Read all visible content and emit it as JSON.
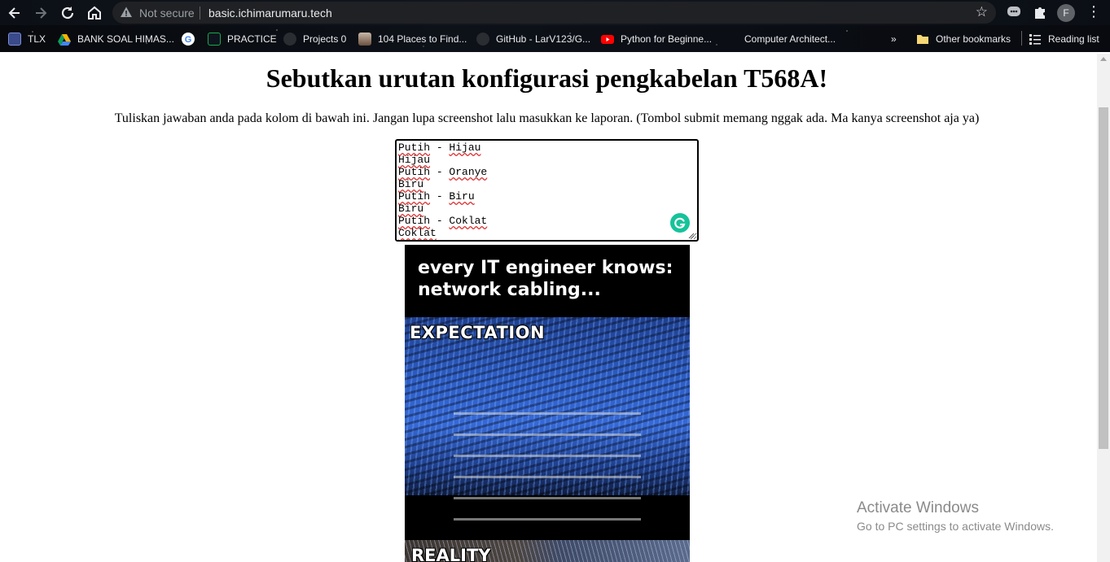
{
  "browser": {
    "security_label": "Not secure",
    "url": "basic.ichimarumaru.tech",
    "profile_initial": "F",
    "more_bookmarks": "»",
    "bookmarks": [
      {
        "label": "TLX",
        "icon": "tlx-icon",
        "color": "#7a8fd6"
      },
      {
        "label": "BANK SOAL HIMAS...",
        "icon": "google-drive-icon",
        "color": "#f4b400"
      },
      {
        "label": "",
        "icon": "google-icon",
        "color": "#ffffff"
      },
      {
        "label": "PRACTICE",
        "icon": "hackerrank-icon",
        "color": "#1ba94c"
      },
      {
        "label": "Projects 0",
        "icon": "github-icon",
        "color": "#9aa0a6"
      },
      {
        "label": "104 Places to Find...",
        "icon": "thumbnail-icon",
        "color": "#8a6d5a"
      },
      {
        "label": "GitHub - LarV123/G...",
        "icon": "github-icon",
        "color": "#9aa0a6"
      },
      {
        "label": "Python for Beginne...",
        "icon": "youtube-icon",
        "color": "#ff0000"
      },
      {
        "label": "Computer Architect...",
        "icon": "blank-page-icon",
        "color": "#000000"
      }
    ],
    "other_bookmarks": "Other bookmarks",
    "reading_list": "Reading list"
  },
  "page": {
    "title": "Sebutkan urutan konfigurasi pengkabelan T568A!",
    "instructions": "Tuliskan jawaban anda pada kolom di bawah ini. Jangan lupa screenshot lalu masukkan ke laporan. (Tombol submit memang nggak ada. Ma kanya screenshot aja ya)",
    "answer_lines": [
      [
        "Putih",
        " - ",
        "Hijau"
      ],
      [
        "Hijau"
      ],
      [
        "Putih",
        " - ",
        "Oranye"
      ],
      [
        "Biru"
      ],
      [
        "Putih",
        " - ",
        "Biru"
      ],
      [
        "Biru"
      ],
      [
        "Putih",
        " - ",
        "Coklat"
      ],
      [
        "Coklat"
      ]
    ],
    "meme": {
      "headline_1": "every IT engineer knows:",
      "headline_2": "network cabling...",
      "label_expectation": "EXPECTATION",
      "label_reality": "REALITY"
    }
  },
  "overlay": {
    "activate_title": "Activate Windows",
    "activate_sub": "Go to PC settings to activate Windows."
  },
  "colors": {
    "chrome_bg": "#0c1016",
    "omnibox_bg": "#202124",
    "grammarly": "#15c39a",
    "cable_blue": "#2d5dc4"
  }
}
